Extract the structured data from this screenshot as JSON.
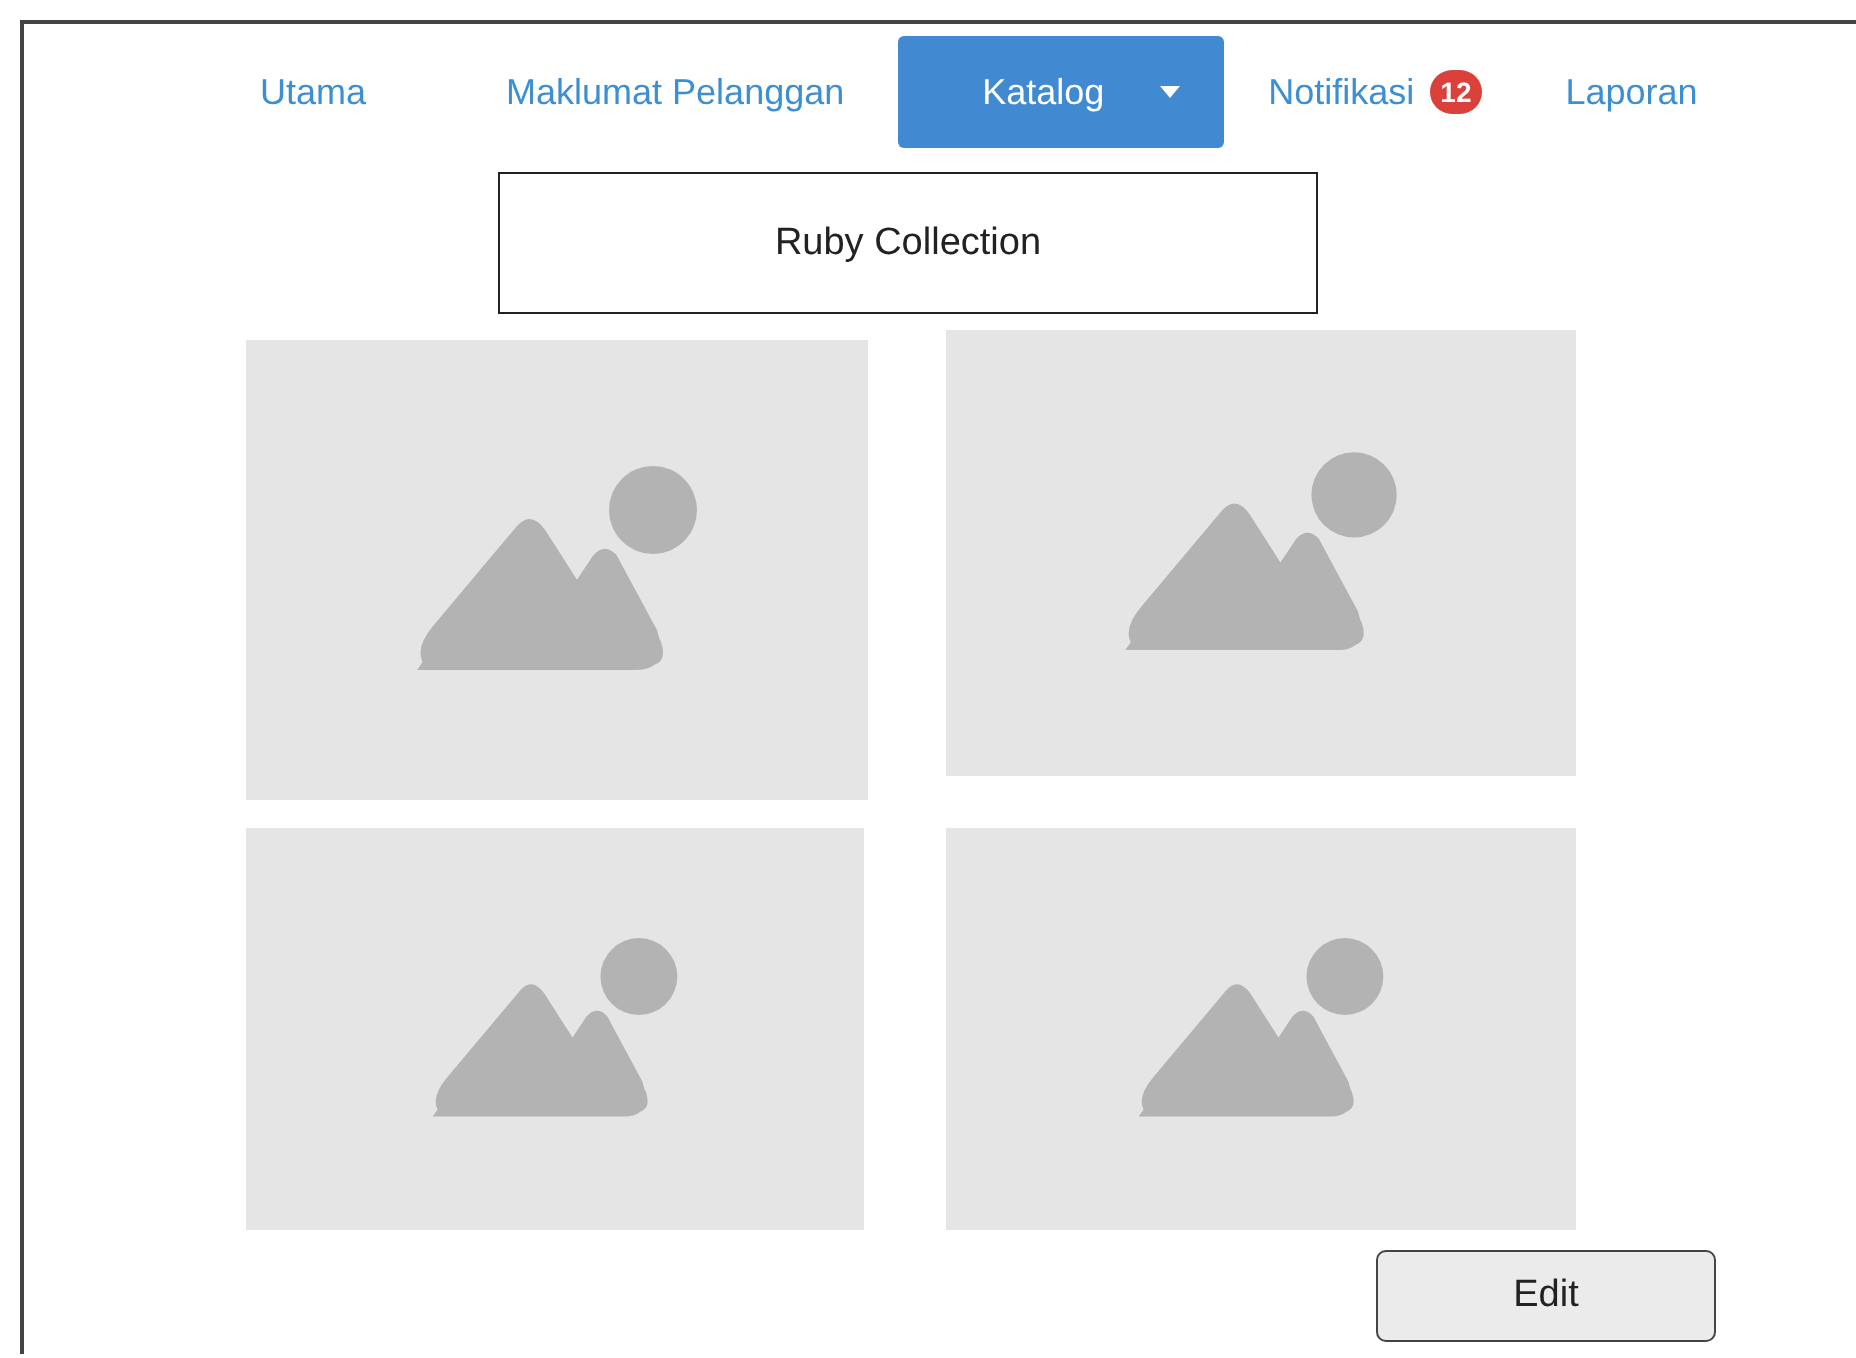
{
  "nav": [
    {
      "label": "Utama",
      "selected": false
    },
    {
      "label": "Maklumat Pelanggan",
      "selected": false
    },
    {
      "label": "Katalog",
      "selected": true,
      "dropdown": true
    },
    {
      "label": "Notifikasi",
      "selected": false,
      "badge": "12"
    },
    {
      "label": "Laporan",
      "selected": false
    }
  ],
  "collection_title": "Ruby Collection",
  "buttons": [
    "Edit"
  ]
}
